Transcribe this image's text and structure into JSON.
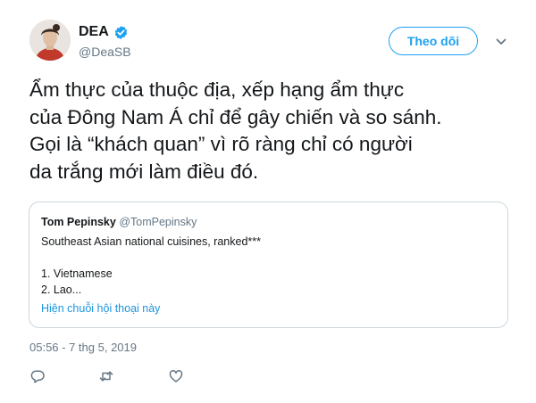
{
  "author": {
    "display_name": "DEA",
    "handle": "@DeaSB",
    "verified_icon": "verified-badge-icon"
  },
  "follow_button_label": "Theo dõi",
  "tweet_lines": [
    "Ẩm thực của thuộc địa, xếp hạng ẩm thực",
    "của Đông Nam Á chỉ để gây chiến và so sánh.",
    "Gọi là “khách quan” vì rõ ràng chỉ có người",
    "da trắng mới làm điều đó."
  ],
  "quoted_tweet": {
    "author_name": "Tom Pepinsky",
    "author_handle": "@TomPepinsky",
    "body_lines": [
      "Southeast Asian national cuisines, ranked***",
      "",
      "1. Vietnamese",
      "2. Lao..."
    ],
    "thread_link": "Hiện chuỗi hội thoại này"
  },
  "timestamp": "05:56 - 7 thg 5, 2019",
  "actions": [
    "reply-icon",
    "retweet-icon",
    "like-icon"
  ],
  "colors": {
    "accent": "#1da1f2",
    "link": "#1b95e0",
    "muted": "#657786",
    "border": "#ccd6dd"
  }
}
